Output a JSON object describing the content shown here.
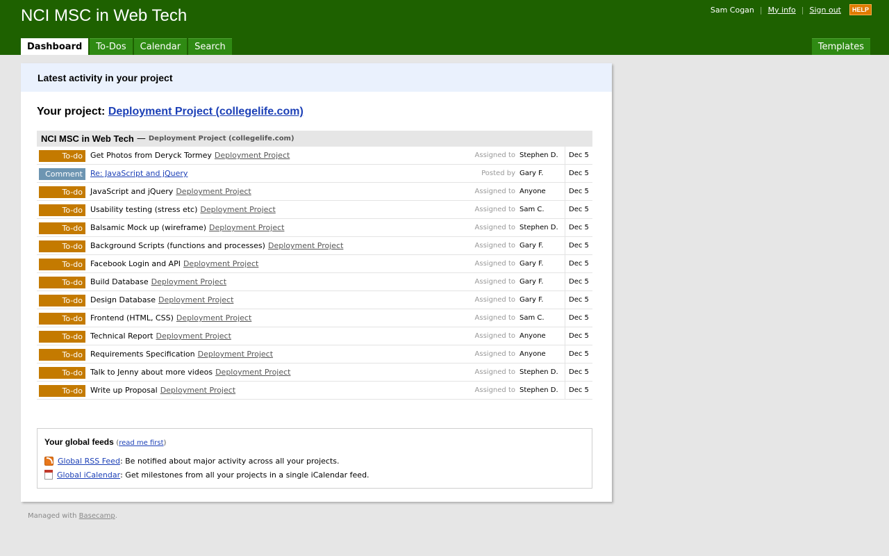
{
  "header": {
    "title": "NCI MSC in Web Tech",
    "user_name": "Sam Cogan",
    "my_info": "My info",
    "sign_out": "Sign out",
    "help": "HELP",
    "tabs": [
      {
        "label": "Dashboard",
        "active": true
      },
      {
        "label": "To-Dos"
      },
      {
        "label": "Calendar"
      },
      {
        "label": "Search"
      }
    ],
    "templates": "Templates",
    "bg_color": "#1e6100"
  },
  "panel": {
    "title": "Latest activity in your project",
    "your_project_label": "Your project:",
    "project_link": "Deployment Project (collegelife.com)"
  },
  "activity": {
    "group_name": "NCI MSC in Web Tech",
    "group_dash": "—",
    "group_sub": "Deployment Project (collegelife.com)",
    "rows": [
      {
        "type": "To-do",
        "title": "Get Photos from Deryck Tormey",
        "project": "Deployment Project",
        "meta_label": "Assigned to",
        "who": "Stephen D.",
        "date": "Dec 5"
      },
      {
        "type": "Comment",
        "title": "Re: JavaScript and jQuery",
        "project": "",
        "meta_label": "Posted by",
        "who": "Gary F.",
        "date": "Dec 5"
      },
      {
        "type": "To-do",
        "title": "JavaScript and jQuery",
        "project": "Deployment Project",
        "meta_label": "Assigned to",
        "who": "Anyone",
        "date": "Dec 5"
      },
      {
        "type": "To-do",
        "title": "Usability testing (stress etc)",
        "project": "Deployment Project",
        "meta_label": "Assigned to",
        "who": "Sam C.",
        "date": "Dec 5"
      },
      {
        "type": "To-do",
        "title": "Balsamic Mock up (wireframe)",
        "project": "Deployment Project",
        "meta_label": "Assigned to",
        "who": "Stephen D.",
        "date": "Dec 5"
      },
      {
        "type": "To-do",
        "title": "Background Scripts (functions and processes)",
        "project": "Deployment Project",
        "meta_label": "Assigned to",
        "who": "Gary F.",
        "date": "Dec 5"
      },
      {
        "type": "To-do",
        "title": "Facebook Login and API",
        "project": "Deployment Project",
        "meta_label": "Assigned to",
        "who": "Gary F.",
        "date": "Dec 5"
      },
      {
        "type": "To-do",
        "title": "Build Database",
        "project": "Deployment Project",
        "meta_label": "Assigned to",
        "who": "Gary F.",
        "date": "Dec 5"
      },
      {
        "type": "To-do",
        "title": "Design Database",
        "project": "Deployment Project",
        "meta_label": "Assigned to",
        "who": "Gary F.",
        "date": "Dec 5"
      },
      {
        "type": "To-do",
        "title": "Frontend (HTML, CSS)",
        "project": "Deployment Project",
        "meta_label": "Assigned to",
        "who": "Sam C.",
        "date": "Dec 5"
      },
      {
        "type": "To-do",
        "title": "Technical Report",
        "project": "Deployment Project",
        "meta_label": "Assigned to",
        "who": "Anyone",
        "date": "Dec 5"
      },
      {
        "type": "To-do",
        "title": "Requirements Specification",
        "project": "Deployment Project",
        "meta_label": "Assigned to",
        "who": "Anyone",
        "date": "Dec 5"
      },
      {
        "type": "To-do",
        "title": "Talk to Jenny about more videos",
        "project": "Deployment Project",
        "meta_label": "Assigned to",
        "who": "Stephen D.",
        "date": "Dec 5"
      },
      {
        "type": "To-do",
        "title": "Write up Proposal",
        "project": "Deployment Project",
        "meta_label": "Assigned to",
        "who": "Stephen D.",
        "date": "Dec 5"
      }
    ]
  },
  "feeds": {
    "title": "Your global feeds",
    "read_open": "(",
    "read_link": "read me first",
    "read_close": ")",
    "items": [
      {
        "icon": "rss-icon",
        "link": "Global RSS Feed",
        "desc": ": Be notified about major activity across all your projects."
      },
      {
        "icon": "calendar-icon",
        "link": "Global iCalendar",
        "desc": ": Get milestones from all your projects in a single iCalendar feed."
      }
    ]
  },
  "footer": {
    "text": "Managed with",
    "link": "Basecamp",
    "end": "."
  }
}
